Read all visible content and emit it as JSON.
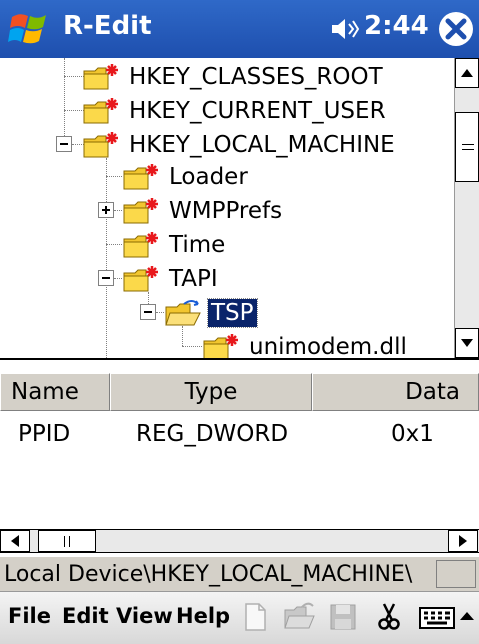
{
  "titlebar": {
    "app_title": "R-Edit",
    "clock": "2:44",
    "start_icon": "windows-flag-icon",
    "speaker_icon": "speaker-icon",
    "close_icon": "close-icon"
  },
  "tree": {
    "items": [
      {
        "label": "HKEY_CLASSES_ROOT",
        "icon": "folder-icon"
      },
      {
        "label": "HKEY_CURRENT_USER",
        "icon": "folder-icon"
      },
      {
        "label": "HKEY_LOCAL_MACHINE",
        "icon": "folder-icon",
        "expanded": true
      },
      {
        "label": "Loader",
        "icon": "folder-icon"
      },
      {
        "label": "WMPPrefs",
        "icon": "folder-icon",
        "expanded": false
      },
      {
        "label": "Time",
        "icon": "folder-icon"
      },
      {
        "label": "TAPI",
        "icon": "folder-icon",
        "expanded": true
      },
      {
        "label": "TSP",
        "icon": "open-folder-icon",
        "expanded": true,
        "selected": true
      },
      {
        "label": "unimodem.dll",
        "icon": "folder-icon"
      }
    ]
  },
  "list": {
    "columns": [
      "Name",
      "Type",
      "Data"
    ],
    "rows": [
      {
        "name": "PPID",
        "type": "REG_DWORD",
        "data": "0x1"
      }
    ]
  },
  "status": {
    "path": "Local Device\\HKEY_LOCAL_MACHINE\\"
  },
  "menubar": {
    "items": [
      "File",
      "Edit",
      "View",
      "Help"
    ],
    "toolbar_icons": [
      "new-document-icon",
      "open-folder-icon",
      "save-icon",
      "cut-icon",
      "keyboard-icon",
      "chevron-up-icon"
    ]
  },
  "colors": {
    "titlebar": "#1e4fae",
    "selection": "#0a246a",
    "folder": "#f2c62f",
    "star": "#e8181c"
  }
}
